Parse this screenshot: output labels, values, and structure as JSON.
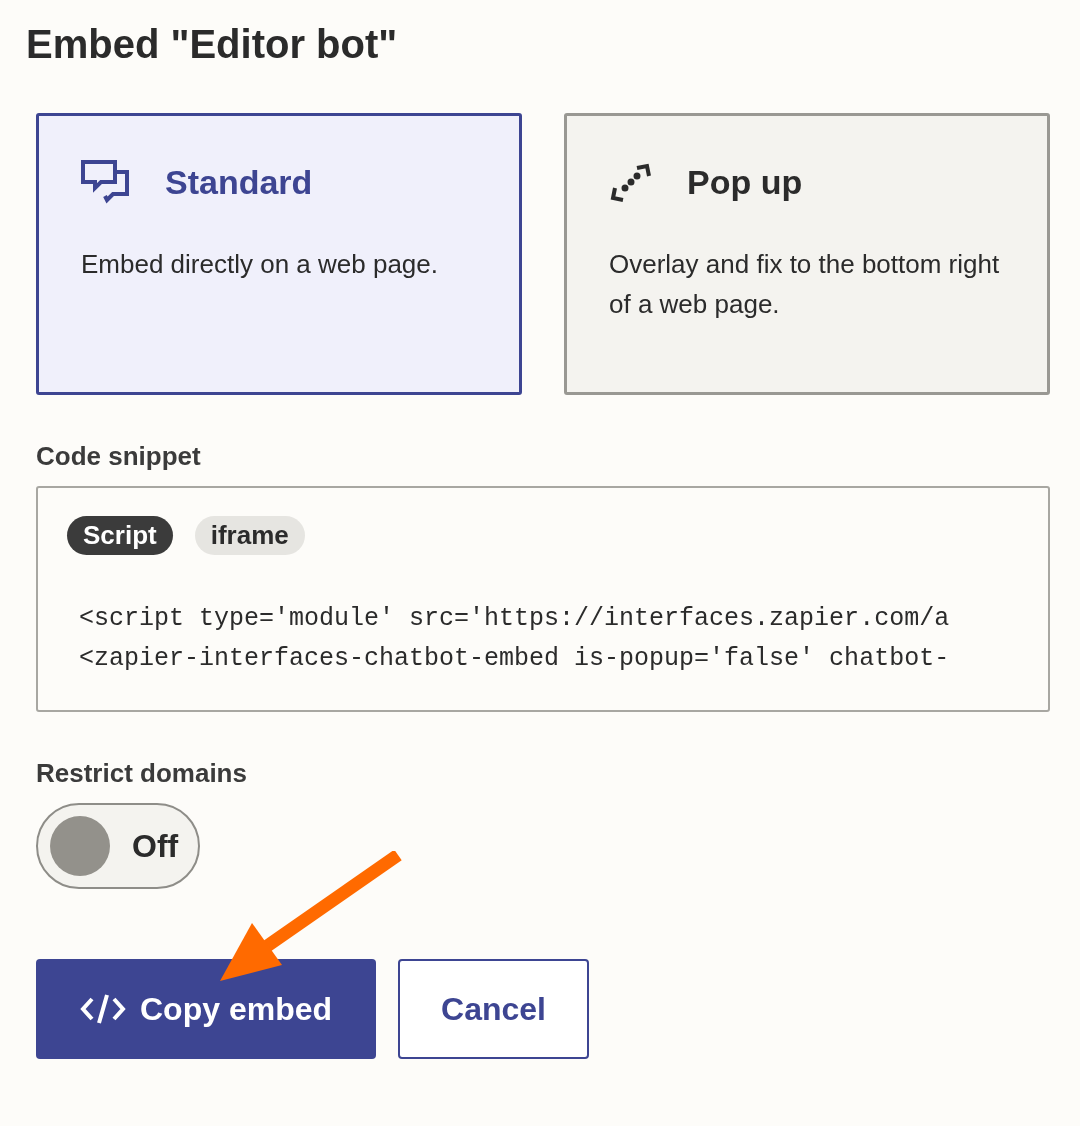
{
  "title": "Embed \"Editor bot\"",
  "embed_types": [
    {
      "kind": "standard",
      "label": "Standard",
      "description": "Embed directly on a web page.",
      "selected": true
    },
    {
      "kind": "popup",
      "label": "Pop up",
      "description": "Overlay and fix to the bottom right of a web page.",
      "selected": false
    }
  ],
  "code_snippet": {
    "label": "Code snippet",
    "tabs": [
      {
        "label": "Script",
        "selected": true
      },
      {
        "label": "iframe",
        "selected": false
      }
    ],
    "lines": [
      "<script type='module' src='https://interfaces.zapier.com/a",
      "<zapier-interfaces-chatbot-embed is-popup='false' chatbot-"
    ]
  },
  "restrict_domains": {
    "label": "Restrict domains",
    "on": false,
    "state_label": "Off"
  },
  "buttons": [
    {
      "kind": "primary",
      "label": "Copy embed"
    },
    {
      "kind": "secondary",
      "label": "Cancel"
    }
  ]
}
